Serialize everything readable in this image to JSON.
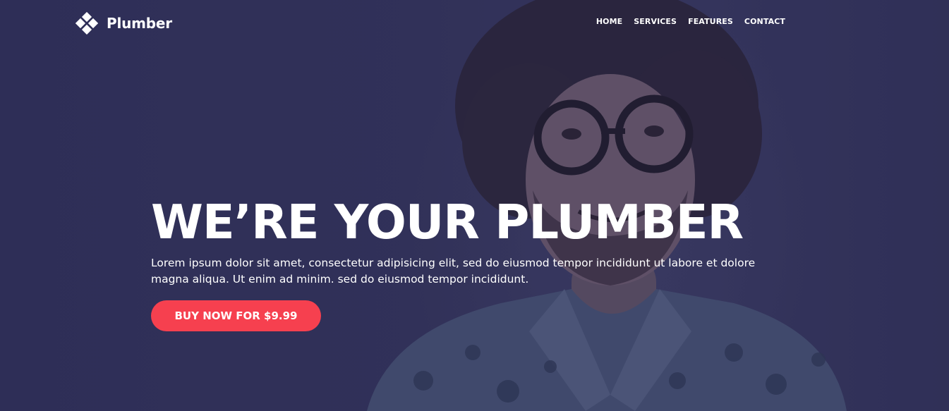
{
  "brand": {
    "name": "Plumber"
  },
  "nav": {
    "items": [
      {
        "label": "HOME"
      },
      {
        "label": "SERVICES"
      },
      {
        "label": "FEATURES"
      },
      {
        "label": "CONTACT"
      }
    ]
  },
  "hero": {
    "title": "WE’RE YOUR PLUMBER",
    "text": "Lorem ipsum dolor sit amet, consectetur adipisicing elit, sed do eiusmod tempor incididunt ut labore et dolore magna aliqua. Ut enim ad minim. sed do eiusmod tempor incididunt.",
    "cta_label": "BUY NOW FOR $9.99"
  },
  "colors": {
    "background": "#34345a",
    "accent": "#f6404f",
    "text": "#ffffff"
  },
  "icons": {
    "logo": "diamond-cluster-logo-icon"
  }
}
